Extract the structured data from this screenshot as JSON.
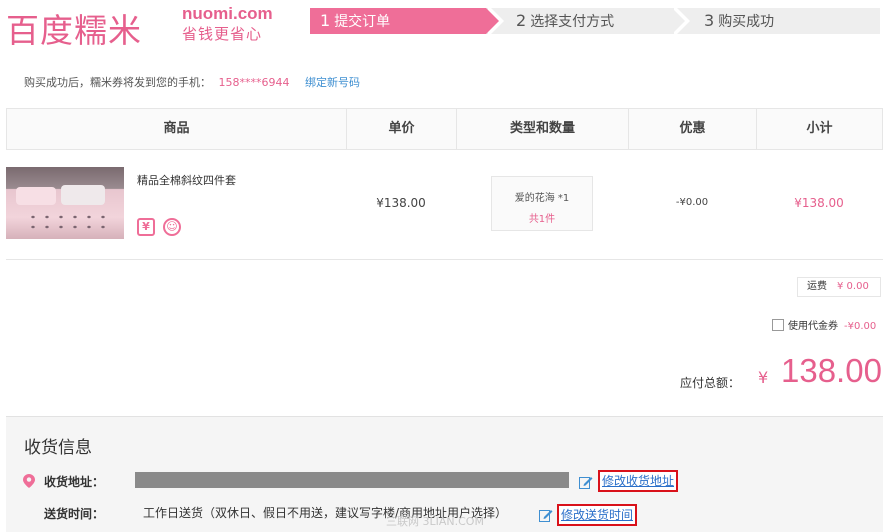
{
  "logo": {
    "cn": "百度糯米",
    "en": "nuomi.com",
    "slogan": "省钱更省心"
  },
  "steps": [
    {
      "num": "1",
      "label": "提交订单",
      "active": true
    },
    {
      "num": "2",
      "label": "选择支付方式",
      "active": false
    },
    {
      "num": "3",
      "label": "购买成功",
      "active": false
    }
  ],
  "notice": {
    "text": "购买成功后，糯米券将发到您的手机：",
    "phone": "158****6944",
    "bind_link": "绑定新号码"
  },
  "table": {
    "headers": [
      "商品",
      "单价",
      "类型和数量",
      "优惠",
      "小计"
    ],
    "rows": [
      {
        "name": "精品全棉斜纹四件套",
        "badges": [
          "¥",
          "☺"
        ],
        "price": "¥138.00",
        "type": "爱的花海 *1",
        "qty": "共1件",
        "discount": "-¥0.00",
        "subtotal": "¥138.00"
      }
    ]
  },
  "freight": {
    "label": "运费",
    "value": "¥ 0.00"
  },
  "voucher": {
    "label": "使用代金券",
    "value": "-¥0.00"
  },
  "total": {
    "label": "应付总额：",
    "currency": "¥",
    "amount": "138.00"
  },
  "shipping": {
    "title": "收货信息",
    "address_label": "收货地址：",
    "edit_address": "修改收货地址",
    "time_label": "送货时间：",
    "time_text": "工作日送货（双休日、假日不用送，建议写字楼/商用地址用户选择）",
    "edit_time": "修改送货时间",
    "watermark": "三联网 3LIAN.COM"
  },
  "colors": {
    "brand": "#e65f8d",
    "step_active": "#ef6e98",
    "highlight_border": "#d9111a",
    "link": "#2a6fc9"
  }
}
